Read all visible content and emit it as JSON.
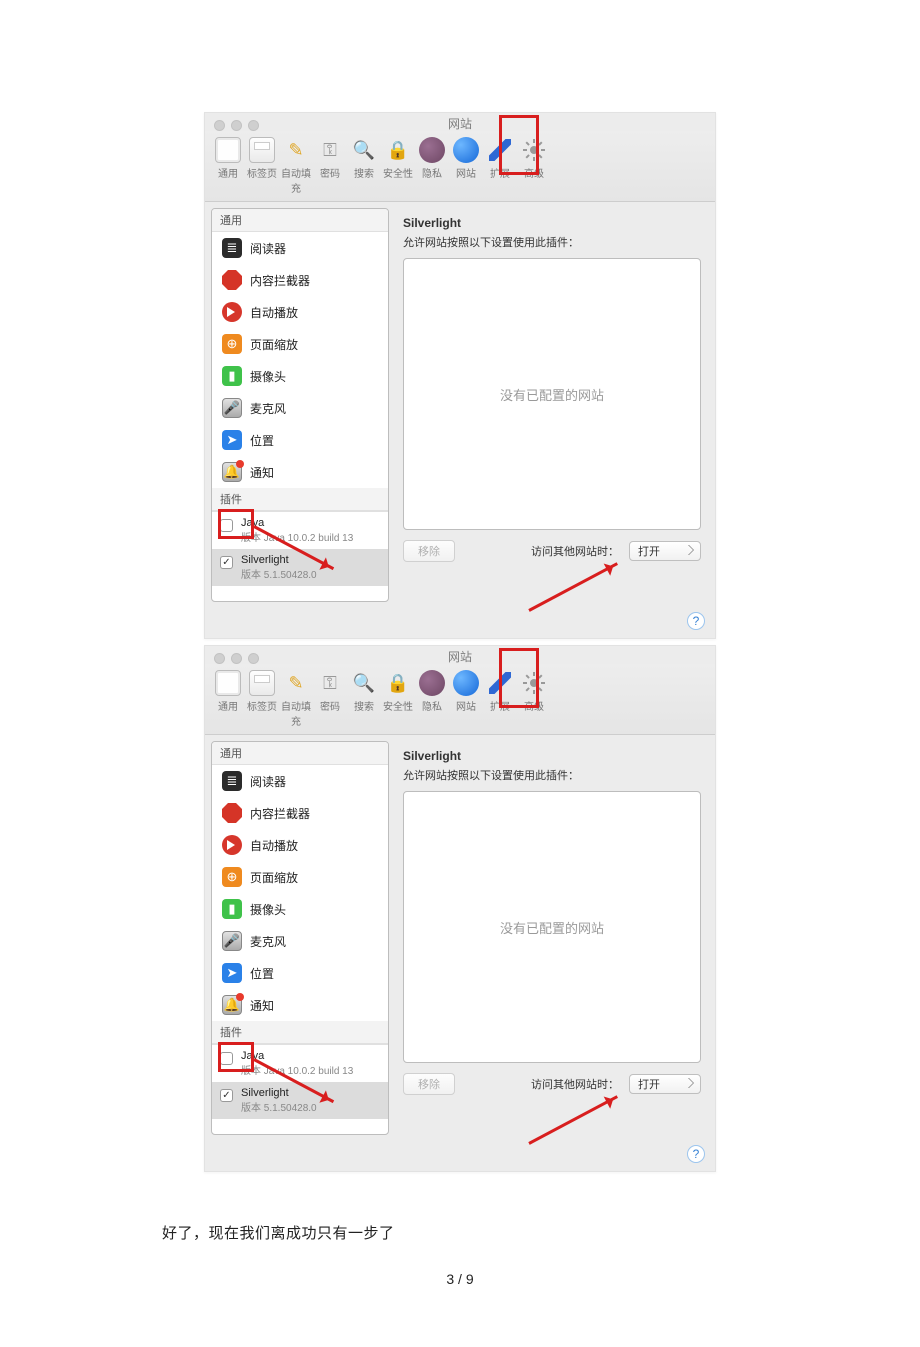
{
  "window": {
    "title": "网站",
    "toolbar": [
      {
        "name": "general",
        "label": "通用"
      },
      {
        "name": "tabs",
        "label": "标签页"
      },
      {
        "name": "autofill",
        "label": "自动填充"
      },
      {
        "name": "passwords",
        "label": "密码"
      },
      {
        "name": "search",
        "label": "搜索"
      },
      {
        "name": "security",
        "label": "安全性"
      },
      {
        "name": "privacy",
        "label": "隐私"
      },
      {
        "name": "websites",
        "label": "网站"
      },
      {
        "name": "extensions",
        "label": "扩展"
      },
      {
        "name": "advanced",
        "label": "高级"
      }
    ]
  },
  "sidebar": {
    "section_general": "通用",
    "items": [
      {
        "name": "reader",
        "label": "阅读器"
      },
      {
        "name": "block",
        "label": "内容拦截器"
      },
      {
        "name": "autoplay",
        "label": "自动播放"
      },
      {
        "name": "zoom",
        "label": "页面缩放"
      },
      {
        "name": "camera",
        "label": "摄像头"
      },
      {
        "name": "mic",
        "label": "麦克风"
      },
      {
        "name": "location",
        "label": "位置"
      },
      {
        "name": "notif",
        "label": "通知"
      }
    ],
    "section_plugins": "插件",
    "plugins": [
      {
        "name": "Java",
        "ver": "版本 Java 10.0.2 build 13",
        "checked": false
      },
      {
        "name": "Silverlight",
        "ver": "版本 5.1.50428.0",
        "checked": true
      }
    ]
  },
  "main": {
    "title": "Silverlight",
    "subtitle": "允许网站按照以下设置使用此插件：",
    "empty": "没有已配置的网站",
    "remove_btn": "移除",
    "visit_label": "访问其他网站时：",
    "select_value": "打开"
  },
  "body_text": "好了，现在我们离成功只有一步了",
  "page_num": "3 / 9"
}
